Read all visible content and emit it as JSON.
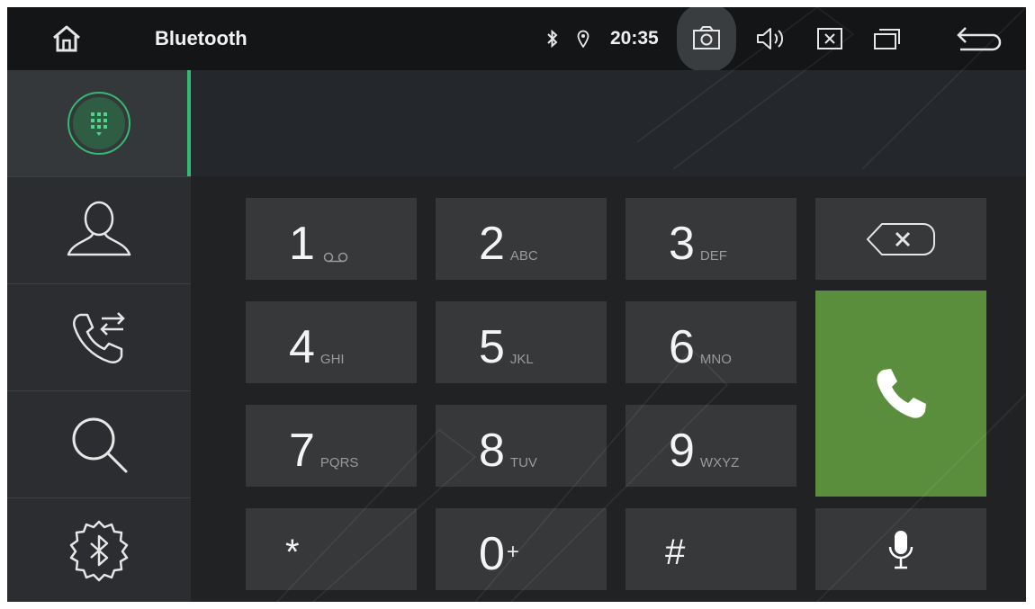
{
  "status_bar": {
    "title": "Bluetooth",
    "time": "20:35",
    "icons": [
      "home-icon",
      "bluetooth-icon",
      "location-icon",
      "camera-icon",
      "volume-icon",
      "close-window-icon",
      "recent-apps-icon",
      "back-icon"
    ]
  },
  "sidebar": {
    "items": [
      {
        "name": "dialpad",
        "icon": "dialpad-icon",
        "active": true
      },
      {
        "name": "contacts",
        "icon": "contact-icon"
      },
      {
        "name": "call-log",
        "icon": "call-log-icon"
      },
      {
        "name": "search",
        "icon": "search-icon"
      },
      {
        "name": "bluetooth-settings",
        "icon": "bluetooth-settings-icon"
      }
    ],
    "accent_color": "#35b873"
  },
  "dialer": {
    "number": "",
    "keys": [
      {
        "digit": "1",
        "letters": "voicemail-icon"
      },
      {
        "digit": "2",
        "letters": "ABC"
      },
      {
        "digit": "3",
        "letters": "DEF"
      },
      {
        "digit": "4",
        "letters": "GHI"
      },
      {
        "digit": "5",
        "letters": "JKL"
      },
      {
        "digit": "6",
        "letters": "MNO"
      },
      {
        "digit": "7",
        "letters": "PQRS"
      },
      {
        "digit": "8",
        "letters": "TUV"
      },
      {
        "digit": "9",
        "letters": "WXYZ"
      },
      {
        "digit": "*",
        "letters": ""
      },
      {
        "digit": "0",
        "letters": "+"
      },
      {
        "digit": "#",
        "letters": ""
      }
    ],
    "call_color": "#5b8e3c",
    "action_icons": [
      "backspace-icon",
      "call-icon",
      "microphone-icon"
    ]
  }
}
